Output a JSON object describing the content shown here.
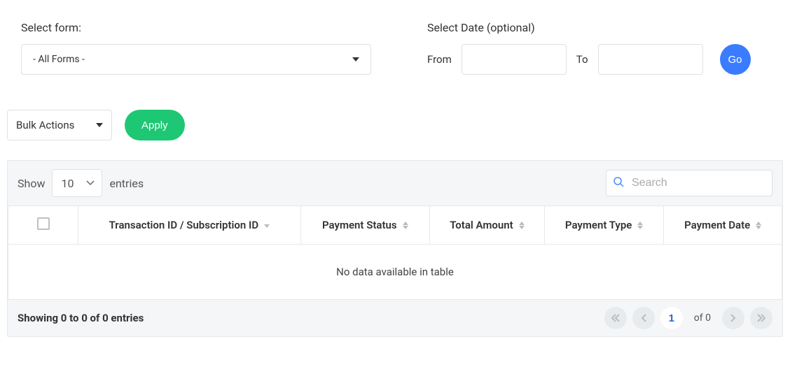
{
  "filters": {
    "select_form_label": "Select form:",
    "select_form_value": "- All Forms -",
    "select_date_label": "Select Date (optional)",
    "from_label": "From",
    "to_label": "To",
    "go_label": "Go"
  },
  "bulk": {
    "label": "Bulk Actions",
    "apply_label": "Apply"
  },
  "table_controls": {
    "show_label": "Show",
    "entries_value": "10",
    "entries_label": "entries",
    "search_placeholder": "Search"
  },
  "columns": {
    "transaction_id": "Transaction ID / Subscription ID",
    "payment_status": "Payment Status",
    "total_amount": "Total Amount",
    "payment_type": "Payment Type",
    "payment_date": "Payment Date"
  },
  "table": {
    "no_data": "No data available in table"
  },
  "footer": {
    "info": "Showing 0 to 0 of 0 entries",
    "current_page": "1",
    "of_text": "of 0"
  }
}
